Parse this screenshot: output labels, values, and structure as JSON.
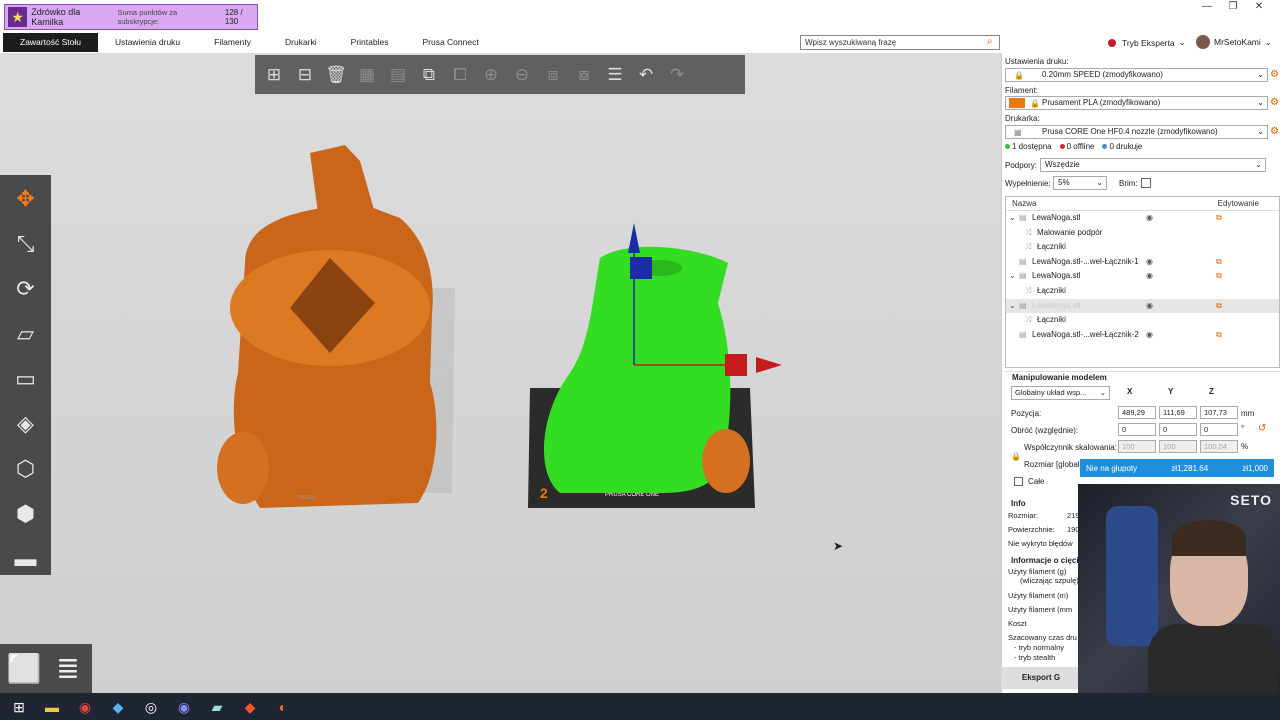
{
  "overlay": {
    "title": "Zdrówko dla Kamilka",
    "subtitle": "Suma punktów za subskrypcje:",
    "count": "128 / 130"
  },
  "window_controls": [
    "—",
    "❐",
    "✕"
  ],
  "menu": {
    "tabs": [
      "Zawartość Stołu",
      "Ustawienia druku",
      "Filamenty",
      "Drukarki",
      "Printables",
      "Prusa Connect"
    ]
  },
  "search": {
    "placeholder": "Wpisz wyszukiwaną frazę"
  },
  "mode": {
    "label": "Tryb Eksperta"
  },
  "user": {
    "name": "MrSetoKami"
  },
  "sidebar": {
    "print_settings_label": "Ustawienia druku:",
    "print_settings_value": "0.20mm SPEED (zmodyfikowano)",
    "filament_label": "Filament:",
    "filament_value": "Prusament PLA (zmodyfikowano)",
    "filament_color": "#e87a10",
    "printer_label": "Drukarka:",
    "printer_value": "Prusa CORE One HF0.4 nozzle (zmodyfikowano)",
    "status_available": "1 dostępna",
    "status_offline": "0 offline",
    "status_printing": "0 drukuje",
    "supports_label": "Podpory:",
    "supports_value": "Wszędzie",
    "infill_label": "Wypełnienie:",
    "infill_value": "5%",
    "brim_label": "Brim:"
  },
  "objects": {
    "col_name": "Nazwa",
    "col_edit": "Edytowanie",
    "rows": [
      {
        "name": "LewaNoga.stl",
        "indent": 0,
        "expanded": true,
        "eye": true,
        "edit": true,
        "selected": false
      },
      {
        "name": "Malowanie podpór",
        "indent": 1,
        "expanded": false,
        "eye": false,
        "edit": false,
        "selected": false
      },
      {
        "name": "Łączniki",
        "indent": 1,
        "expanded": false,
        "eye": false,
        "edit": false,
        "selected": false
      },
      {
        "name": "LewaNoga.stl-...wel-Łącznik-1",
        "indent": 0,
        "expanded": false,
        "eye": true,
        "edit": true,
        "selected": false
      },
      {
        "name": "LewaNoga.stl",
        "indent": 0,
        "expanded": true,
        "eye": true,
        "edit": true,
        "selected": false
      },
      {
        "name": "Łączniki",
        "indent": 1,
        "expanded": false,
        "eye": false,
        "edit": false,
        "selected": false
      },
      {
        "name": "LewaNoga.stl",
        "indent": 0,
        "expanded": true,
        "eye": true,
        "edit": true,
        "selected": true
      },
      {
        "name": "Łączniki",
        "indent": 1,
        "expanded": false,
        "eye": false,
        "edit": false,
        "selected": false
      },
      {
        "name": "LewaNoga.stl-...wel-Łącznik-2",
        "indent": 0,
        "expanded": false,
        "eye": true,
        "edit": true,
        "selected": false
      }
    ]
  },
  "manipulation": {
    "title": "Manipulowanie modelem",
    "coord_system": "Globalny układ wsp...",
    "axes": [
      "X",
      "Y",
      "Z"
    ],
    "position_label": "Pozycja:",
    "position": [
      "489,29",
      "111,69",
      "107,73"
    ],
    "position_unit": "mm",
    "rotation_label": "Obróć (względnie):",
    "rotation": [
      "0",
      "0",
      "0"
    ],
    "rotation_unit": "°",
    "scale_label": "Współczynnik skalowania:",
    "scale": [
      "100",
      "100",
      "100,04"
    ],
    "scale_unit": "%",
    "size_label": "Rozmiar [globalny]",
    "whole_label": "Całe"
  },
  "info": {
    "title": "Info",
    "size_label": "Rozmiar:",
    "size_value": "219",
    "surface_label": "Powierzchnie:",
    "surface_value": "190",
    "errors": "Nie wykryto błędów",
    "slice_title": "Informacje o cięciu",
    "filament_g": "Użyty filament (g)",
    "filament_g_sub": "(wliczając szpulę)",
    "filament_m": "Użyty filament (m)",
    "filament_mm": "Użyty filament (mm",
    "cost": "Koszt",
    "time": "Szacowany czas dru",
    "mode_normal": "- tryb normalny",
    "mode_stealth": "- tryb stealth"
  },
  "export_label": "Eksport G",
  "donation": {
    "label": "Nie na głupoty",
    "amount": "zł1,281.64",
    "goal": "zł1,000"
  },
  "webcam": {
    "logo": "SETO"
  },
  "plate_number": "2",
  "plate_brand_left": "PRUSA",
  "plate_brand_right": "PRUSA CORE ONE"
}
